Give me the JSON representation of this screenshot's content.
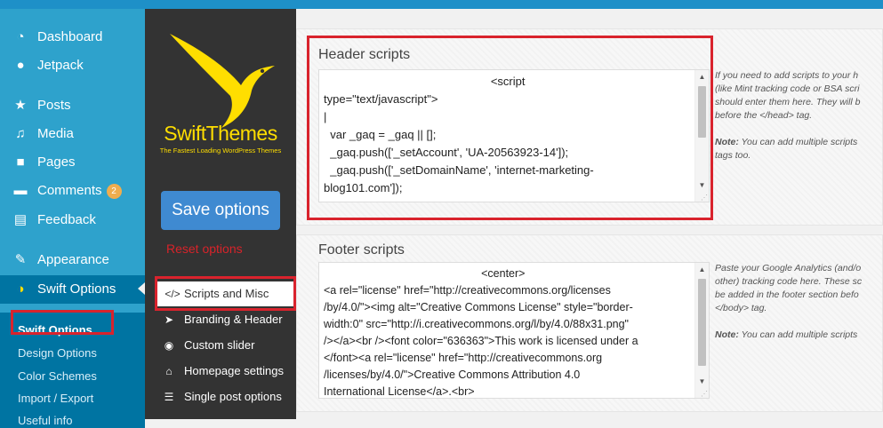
{
  "wp_menu": [
    {
      "label": "Dashboard",
      "icon": "dashboard-icon",
      "glyph": "◔"
    },
    {
      "label": "Jetpack",
      "icon": "jetpack-icon",
      "glyph": "●"
    },
    {
      "label": "Posts",
      "icon": "pushpin-icon",
      "glyph": "★"
    },
    {
      "label": "Media",
      "icon": "media-icon",
      "glyph": "♫"
    },
    {
      "label": "Pages",
      "icon": "pages-icon",
      "glyph": "■"
    },
    {
      "label": "Comments",
      "icon": "comment-icon",
      "glyph": "▬",
      "badge": "2"
    },
    {
      "label": "Feedback",
      "icon": "feedback-icon",
      "glyph": "▤"
    },
    {
      "label": "Appearance",
      "icon": "paintbrush-icon",
      "glyph": "✎"
    },
    {
      "label": "Swift Options",
      "icon": "swift-bird-icon",
      "glyph": "◑"
    }
  ],
  "wp_submenu": [
    "Swift Options",
    "Design Options",
    "Color Schemes",
    "Import / Export",
    "Useful info"
  ],
  "brand": {
    "name": "SwiftThemes",
    "tagline": "The Fastest Loading WordPress Themes",
    "color": "#ffde00"
  },
  "panel": {
    "save_label": "Save options",
    "reset_label": "Reset options",
    "menu": [
      {
        "label": "Scripts and Misc",
        "icon": "code-icon",
        "glyph": "</>"
      },
      {
        "label": "Branding & Header",
        "icon": "rocket-icon",
        "glyph": "➤"
      },
      {
        "label": "Custom slider",
        "icon": "slider-icon",
        "glyph": "◉"
      },
      {
        "label": "Homepage settings",
        "icon": "home-icon",
        "glyph": "⌂"
      },
      {
        "label": "Single post options",
        "icon": "document-icon",
        "glyph": "☰"
      }
    ]
  },
  "header_scripts": {
    "title": "Header scripts",
    "value": "                                                    <script\ntype=\"text/javascript\">\n|\n  var _gaq = _gaq || [];\n  _gaq.push(['_setAccount', 'UA-20563923-14']);\n  _gaq.push(['_setDomainName', 'internet-marketing-\nblog101.com']);",
    "help": [
      "If you need to add scripts to your h",
      "(like Mint tracking code or BSA scri",
      "should enter them here. They will b",
      "before the </head> tag."
    ],
    "note_label": "Note:",
    "note_text": " You can add multiple scripts",
    "note_text2": "tags too."
  },
  "footer_scripts": {
    "title": "Footer scripts",
    "value": "                                                   <center>\n<a rel=\"license\" href=\"http://creativecommons.org/licenses\n/by/4.0/\"><img alt=\"Creative Commons License\" style=\"border-\nwidth:0\" src=\"http://i.creativecommons.org/l/by/4.0/88x31.png\"\n/></a><br /><font color=\"636363\">This work is licensed under a\n</font><a rel=\"license\" href=\"http://creativecommons.org\n/licenses/by/4.0/\">Creative Commons Attribution 4.0\nInternational License</a>.<br>",
    "help": [
      "Paste your Google Analytics (and/o",
      "other) tracking code here. These sc",
      "be added in the footer section befo",
      "</body> tag."
    ],
    "note_label": "Note:",
    "note_text": " You can add multiple scripts"
  },
  "colors": {
    "wp_sidebar": "#2ea2cc",
    "wp_active": "#0074a2",
    "panel_bg": "#333333",
    "save_button": "#3f8ad1",
    "reset": "#d8232a",
    "highlight": "#d9232d"
  }
}
